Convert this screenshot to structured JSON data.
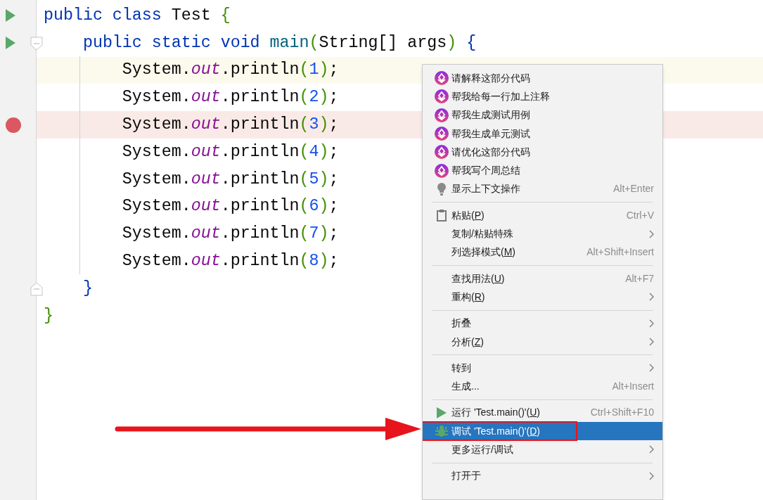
{
  "editor": {
    "lines": [
      {
        "current": false,
        "run": true,
        "breakpoint": false,
        "fold_open": false,
        "fold_close": false,
        "tokens": [
          {
            "t": "public",
            "kind": "keyword"
          },
          {
            "t": " class",
            "kind": "keyword"
          },
          {
            "t": " Test ",
            "kind": "plain"
          },
          {
            "t": "{",
            "kind": "bracket"
          }
        ]
      },
      {
        "current": false,
        "run": true,
        "breakpoint": false,
        "fold_open": true,
        "fold_close": false,
        "tokens": [
          {
            "t": "    public",
            "kind": "keyword"
          },
          {
            "t": " static",
            "kind": "keyword"
          },
          {
            "t": " void",
            "kind": "keyword"
          },
          {
            "t": " main",
            "kind": "method"
          },
          {
            "t": "(",
            "kind": "bracket"
          },
          {
            "t": "String[] args",
            "kind": "plain"
          },
          {
            "t": ")",
            "kind": "bracket"
          },
          {
            "t": " {",
            "kind": "brace"
          }
        ]
      },
      {
        "current": true,
        "run": false,
        "breakpoint": false,
        "fold_open": false,
        "fold_close": false,
        "tokens": [
          {
            "t": "        System.",
            "kind": "plain"
          },
          {
            "t": "out",
            "kind": "field"
          },
          {
            "t": ".println",
            "kind": "plain"
          },
          {
            "t": "(",
            "kind": "bracket"
          },
          {
            "t": "1",
            "kind": "number"
          },
          {
            "t": ")",
            "kind": "bracket"
          },
          {
            "t": ";",
            "kind": "plain"
          }
        ]
      },
      {
        "current": false,
        "run": false,
        "breakpoint": false,
        "fold_open": false,
        "fold_close": false,
        "tokens": [
          {
            "t": "        System.",
            "kind": "plain"
          },
          {
            "t": "out",
            "kind": "field"
          },
          {
            "t": ".println",
            "kind": "plain"
          },
          {
            "t": "(",
            "kind": "bracket"
          },
          {
            "t": "2",
            "kind": "number"
          },
          {
            "t": ")",
            "kind": "bracket"
          },
          {
            "t": ";",
            "kind": "plain"
          }
        ]
      },
      {
        "current": false,
        "run": false,
        "breakpoint": true,
        "fold_open": false,
        "fold_close": false,
        "tokens": [
          {
            "t": "        System.",
            "kind": "plain"
          },
          {
            "t": "out",
            "kind": "field"
          },
          {
            "t": ".println",
            "kind": "plain"
          },
          {
            "t": "(",
            "kind": "bracket"
          },
          {
            "t": "3",
            "kind": "number"
          },
          {
            "t": ")",
            "kind": "bracket"
          },
          {
            "t": ";",
            "kind": "plain"
          }
        ]
      },
      {
        "current": false,
        "run": false,
        "breakpoint": false,
        "fold_open": false,
        "fold_close": false,
        "tokens": [
          {
            "t": "        System.",
            "kind": "plain"
          },
          {
            "t": "out",
            "kind": "field"
          },
          {
            "t": ".println",
            "kind": "plain"
          },
          {
            "t": "(",
            "kind": "bracket"
          },
          {
            "t": "4",
            "kind": "number"
          },
          {
            "t": ")",
            "kind": "bracket"
          },
          {
            "t": ";",
            "kind": "plain"
          }
        ]
      },
      {
        "current": false,
        "run": false,
        "breakpoint": false,
        "fold_open": false,
        "fold_close": false,
        "tokens": [
          {
            "t": "        System.",
            "kind": "plain"
          },
          {
            "t": "out",
            "kind": "field"
          },
          {
            "t": ".println",
            "kind": "plain"
          },
          {
            "t": "(",
            "kind": "bracket"
          },
          {
            "t": "5",
            "kind": "number"
          },
          {
            "t": ")",
            "kind": "bracket"
          },
          {
            "t": ";",
            "kind": "plain"
          }
        ]
      },
      {
        "current": false,
        "run": false,
        "breakpoint": false,
        "fold_open": false,
        "fold_close": false,
        "tokens": [
          {
            "t": "        System.",
            "kind": "plain"
          },
          {
            "t": "out",
            "kind": "field"
          },
          {
            "t": ".println",
            "kind": "plain"
          },
          {
            "t": "(",
            "kind": "bracket"
          },
          {
            "t": "6",
            "kind": "number"
          },
          {
            "t": ")",
            "kind": "bracket"
          },
          {
            "t": ";",
            "kind": "plain"
          }
        ]
      },
      {
        "current": false,
        "run": false,
        "breakpoint": false,
        "fold_open": false,
        "fold_close": false,
        "tokens": [
          {
            "t": "        System.",
            "kind": "plain"
          },
          {
            "t": "out",
            "kind": "field"
          },
          {
            "t": ".println",
            "kind": "plain"
          },
          {
            "t": "(",
            "kind": "bracket"
          },
          {
            "t": "7",
            "kind": "number"
          },
          {
            "t": ")",
            "kind": "bracket"
          },
          {
            "t": ";",
            "kind": "plain"
          }
        ]
      },
      {
        "current": false,
        "run": false,
        "breakpoint": false,
        "fold_open": false,
        "fold_close": false,
        "tokens": [
          {
            "t": "        System.",
            "kind": "plain"
          },
          {
            "t": "out",
            "kind": "field"
          },
          {
            "t": ".println",
            "kind": "plain"
          },
          {
            "t": "(",
            "kind": "bracket"
          },
          {
            "t": "8",
            "kind": "number"
          },
          {
            "t": ")",
            "kind": "bracket"
          },
          {
            "t": ";",
            "kind": "plain"
          }
        ]
      },
      {
        "current": false,
        "run": false,
        "breakpoint": false,
        "fold_open": false,
        "fold_close": true,
        "tokens": [
          {
            "t": "    }",
            "kind": "brace"
          }
        ]
      },
      {
        "current": false,
        "run": false,
        "breakpoint": false,
        "fold_open": false,
        "fold_close": false,
        "tokens": [
          {
            "t": "}",
            "kind": "bracket"
          }
        ]
      }
    ]
  },
  "context_menu": {
    "groups": [
      [
        {
          "kind": "ai",
          "label": "请解释这部分代码",
          "submenu": false,
          "selected": false,
          "outlined": false
        },
        {
          "kind": "ai",
          "label": "帮我给每一行加上注释",
          "submenu": false,
          "selected": false,
          "outlined": false
        },
        {
          "kind": "ai",
          "label": "帮我生成测试用例",
          "submenu": false,
          "selected": false,
          "outlined": false
        },
        {
          "kind": "ai",
          "label": "帮我生成单元测试",
          "submenu": false,
          "selected": false,
          "outlined": false
        },
        {
          "kind": "ai",
          "label": "请优化这部分代码",
          "submenu": false,
          "selected": false,
          "outlined": false
        },
        {
          "kind": "ai",
          "label": "帮我写个周总结",
          "submenu": false,
          "selected": false,
          "outlined": false
        },
        {
          "kind": "hint",
          "label": "显示上下文操作",
          "shortcut": "Alt+Enter",
          "submenu": false,
          "selected": false,
          "outlined": false
        }
      ],
      [
        {
          "kind": "paste",
          "label": "粘贴(",
          "mnemonic": "P",
          "suffix": ")",
          "shortcut": "Ctrl+V",
          "submenu": false,
          "selected": false,
          "outlined": false
        },
        {
          "kind": "plain",
          "label": "复制/粘贴特殊",
          "submenu": true,
          "selected": false,
          "outlined": false
        },
        {
          "kind": "plain",
          "label": "列选择模式(",
          "mnemonic": "M",
          "suffix": ")",
          "shortcut": "Alt+Shift+Insert",
          "submenu": false,
          "selected": false,
          "outlined": false
        }
      ],
      [
        {
          "kind": "plain",
          "label": "查找用法(",
          "mnemonic": "U",
          "suffix": ")",
          "shortcut": "Alt+F7",
          "submenu": false,
          "selected": false,
          "outlined": false
        },
        {
          "kind": "plain",
          "label": "重构(",
          "mnemonic": "R",
          "suffix": ")",
          "submenu": true,
          "selected": false,
          "outlined": false
        }
      ],
      [
        {
          "kind": "plain",
          "label": "折叠",
          "submenu": true,
          "selected": false,
          "outlined": false
        },
        {
          "kind": "plain",
          "label": "分析(",
          "mnemonic": "Z",
          "suffix": ")",
          "submenu": true,
          "selected": false,
          "outlined": false
        }
      ],
      [
        {
          "kind": "plain",
          "label": "转到",
          "submenu": true,
          "selected": false,
          "outlined": false
        },
        {
          "kind": "plain",
          "label": "生成...",
          "shortcut": "Alt+Insert",
          "submenu": false,
          "selected": false,
          "outlined": false
        }
      ],
      [
        {
          "kind": "run",
          "label": "运行 'Test.main()'(",
          "mnemonic": "U",
          "suffix": ")",
          "shortcut": "Ctrl+Shift+F10",
          "submenu": false,
          "selected": false,
          "outlined": false
        },
        {
          "kind": "debug",
          "label": "调试 'Test.main()'(",
          "mnemonic": "D",
          "suffix": ")",
          "submenu": false,
          "selected": true,
          "outlined": true
        },
        {
          "kind": "plain",
          "label": "更多运行/调试",
          "submenu": true,
          "selected": false,
          "outlined": false
        }
      ],
      [
        {
          "kind": "plain",
          "label": "打开于",
          "submenu": true,
          "selected": false,
          "outlined": false
        }
      ]
    ]
  }
}
